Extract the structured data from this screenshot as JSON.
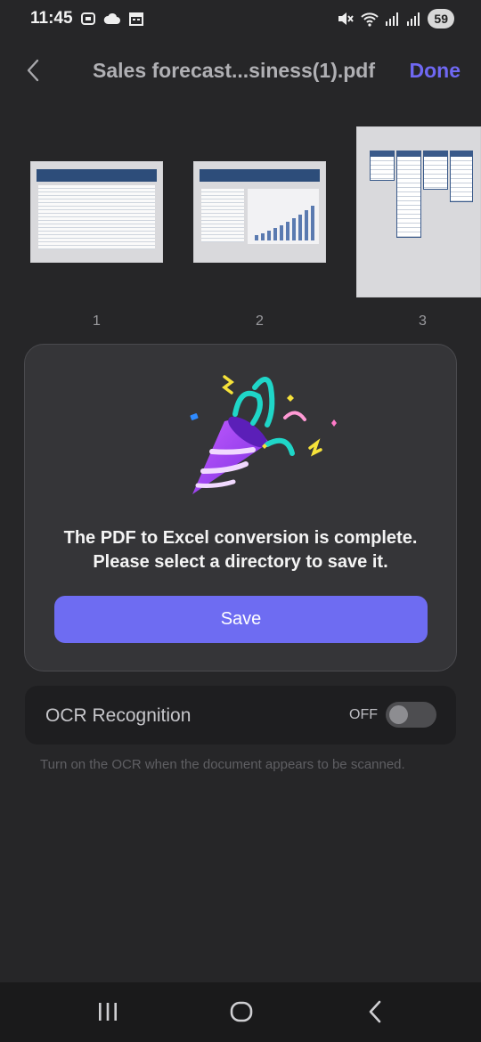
{
  "status_bar": {
    "time": "11:45",
    "battery": "59",
    "icons": [
      "screenshot-icon",
      "cloud-icon",
      "calendar-icon",
      "mute-icon",
      "wifi-icon",
      "signal-icon",
      "signal-icon"
    ]
  },
  "header": {
    "title": "Sales forecast...siness(1).pdf",
    "done_label": "Done",
    "accent_color": "#6f68f3"
  },
  "thumbnails": [
    {
      "number": "1"
    },
    {
      "number": "2"
    },
    {
      "number": "3"
    }
  ],
  "modal": {
    "illustration": "party-popper-icon",
    "message_line1": "The PDF to Excel conversion is complete.",
    "message_line2": "Please select a directory to save it.",
    "save_label": "Save",
    "button_color": "#6e6cf2"
  },
  "ocr": {
    "label": "OCR Recognition",
    "state": "OFF",
    "enabled": false,
    "hint": "Turn on the OCR when the document appears to be scanned."
  },
  "nav_bar": {
    "icons": [
      "recent-apps-icon",
      "home-icon",
      "back-icon"
    ]
  }
}
